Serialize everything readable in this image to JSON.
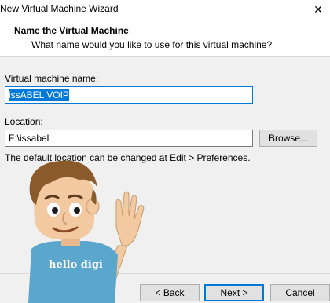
{
  "window": {
    "title": "New Virtual Machine Wizard",
    "close_glyph": "✕"
  },
  "header": {
    "title": "Name the Virtual Machine",
    "subtitle": "What name would you like to use for this virtual machine?"
  },
  "form": {
    "vm_name_label": "Virtual machine name:",
    "vm_name_value": "issABEL VOIP",
    "location_label": "Location:",
    "location_value": "F:\\issabel",
    "browse_label": "Browse...",
    "hint": "The default location can be changed at Edit > Preferences."
  },
  "mascot": {
    "shirt_text": "hello digi"
  },
  "footer": {
    "back_label": "< Back",
    "next_label": "Next >",
    "cancel_label": "Cancel"
  },
  "colors": {
    "accent": "#0078d7",
    "window_bg": "#f0f0f0",
    "mascot_shirt": "#5aa6cc",
    "mascot_hair": "#8a5a2b",
    "mascot_skin": "#f2c9a0"
  },
  "icons": {
    "close": "close-icon"
  }
}
